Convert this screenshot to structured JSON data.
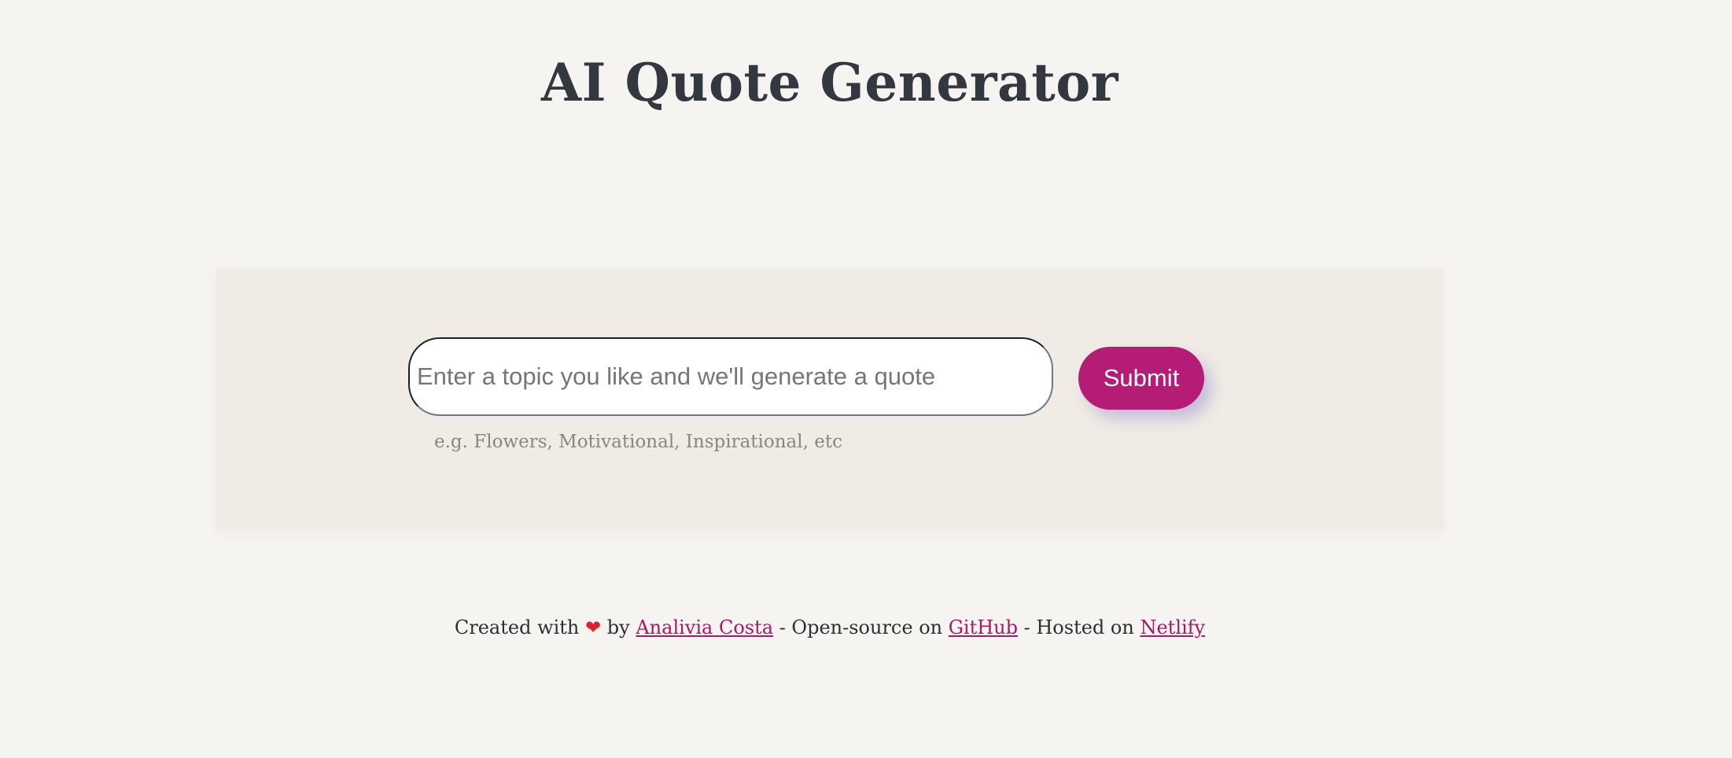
{
  "header": {
    "title": "AI Quote Generator"
  },
  "form": {
    "input_placeholder": "Enter a topic you like and we'll generate a quote",
    "input_value": "",
    "submit_label": "Submit",
    "hint": "e.g. Flowers, Motivational, Inspirational, etc"
  },
  "footer": {
    "created_with": "Created with",
    "heart_icon": "heart-icon",
    "heart_glyph": "❤",
    "by": "by",
    "author_link": "Analivia Costa",
    "open_source_text": "- Open-source on",
    "github_link": "GitHub",
    "hosted_text": "- Hosted on",
    "netlify_link": "Netlify"
  },
  "colors": {
    "background": "#f5f4f0",
    "panel": "#f0ebe4",
    "accent": "#b51c75",
    "title": "#323740",
    "link": "#a81969"
  }
}
